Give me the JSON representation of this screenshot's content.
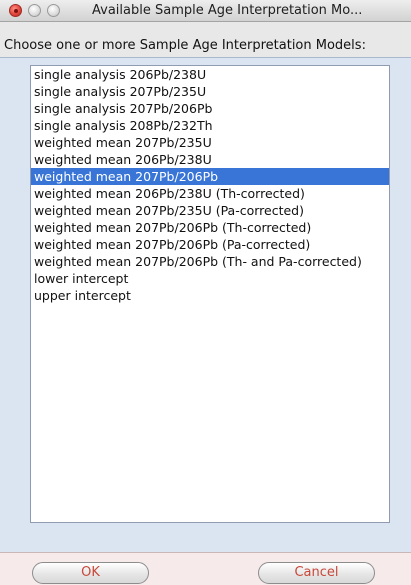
{
  "window": {
    "title": "Available Sample Age Interpretation Mo..."
  },
  "prompt": "Choose one or more Sample Age Interpretation Models:",
  "models": [
    {
      "label": "single analysis 206Pb/238U",
      "selected": false
    },
    {
      "label": "single analysis 207Pb/235U",
      "selected": false
    },
    {
      "label": "single analysis 207Pb/206Pb",
      "selected": false
    },
    {
      "label": "single analysis 208Pb/232Th",
      "selected": false
    },
    {
      "label": "weighted mean 207Pb/235U",
      "selected": false
    },
    {
      "label": "weighted mean 206Pb/238U",
      "selected": false
    },
    {
      "label": "weighted mean 207Pb/206Pb",
      "selected": true
    },
    {
      "label": "weighted mean 206Pb/238U (Th-corrected)",
      "selected": false
    },
    {
      "label": "weighted mean 207Pb/235U (Pa-corrected)",
      "selected": false
    },
    {
      "label": "weighted mean 207Pb/206Pb (Th-corrected)",
      "selected": false
    },
    {
      "label": "weighted mean 207Pb/206Pb (Pa-corrected)",
      "selected": false
    },
    {
      "label": "weighted mean 207Pb/206Pb (Th- and Pa-corrected)",
      "selected": false
    },
    {
      "label": "lower intercept",
      "selected": false
    },
    {
      "label": "upper intercept",
      "selected": false
    }
  ],
  "buttons": {
    "ok": "OK",
    "cancel": "Cancel"
  },
  "colors": {
    "selection": "#3875d7",
    "button_text": "#c8483a",
    "panel": "#dbe4f1"
  }
}
